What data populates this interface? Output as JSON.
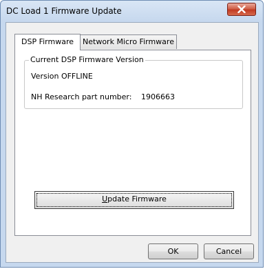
{
  "window": {
    "title": "DC Load 1 Firmware Update"
  },
  "tabs": [
    {
      "label": "DSP Firmware",
      "active": true
    },
    {
      "label": "Network Micro Firmware",
      "active": false
    }
  ],
  "dsp_panel": {
    "group_title": "Current DSP Firmware Version",
    "version_text": "Version OFFLINE",
    "part_number_label": "NH Research part number:",
    "part_number_value": "1906663",
    "update_button": {
      "mnemonic": "U",
      "rest": "pdate Firmware"
    }
  },
  "footer": {
    "ok_label": "OK",
    "cancel_label": "Cancel"
  },
  "icons": {
    "close": "close-x-icon"
  },
  "colors": {
    "close_button": "#c13a22",
    "frame": "#c6d8ee",
    "dialog_bg": "#f0f0f0"
  }
}
